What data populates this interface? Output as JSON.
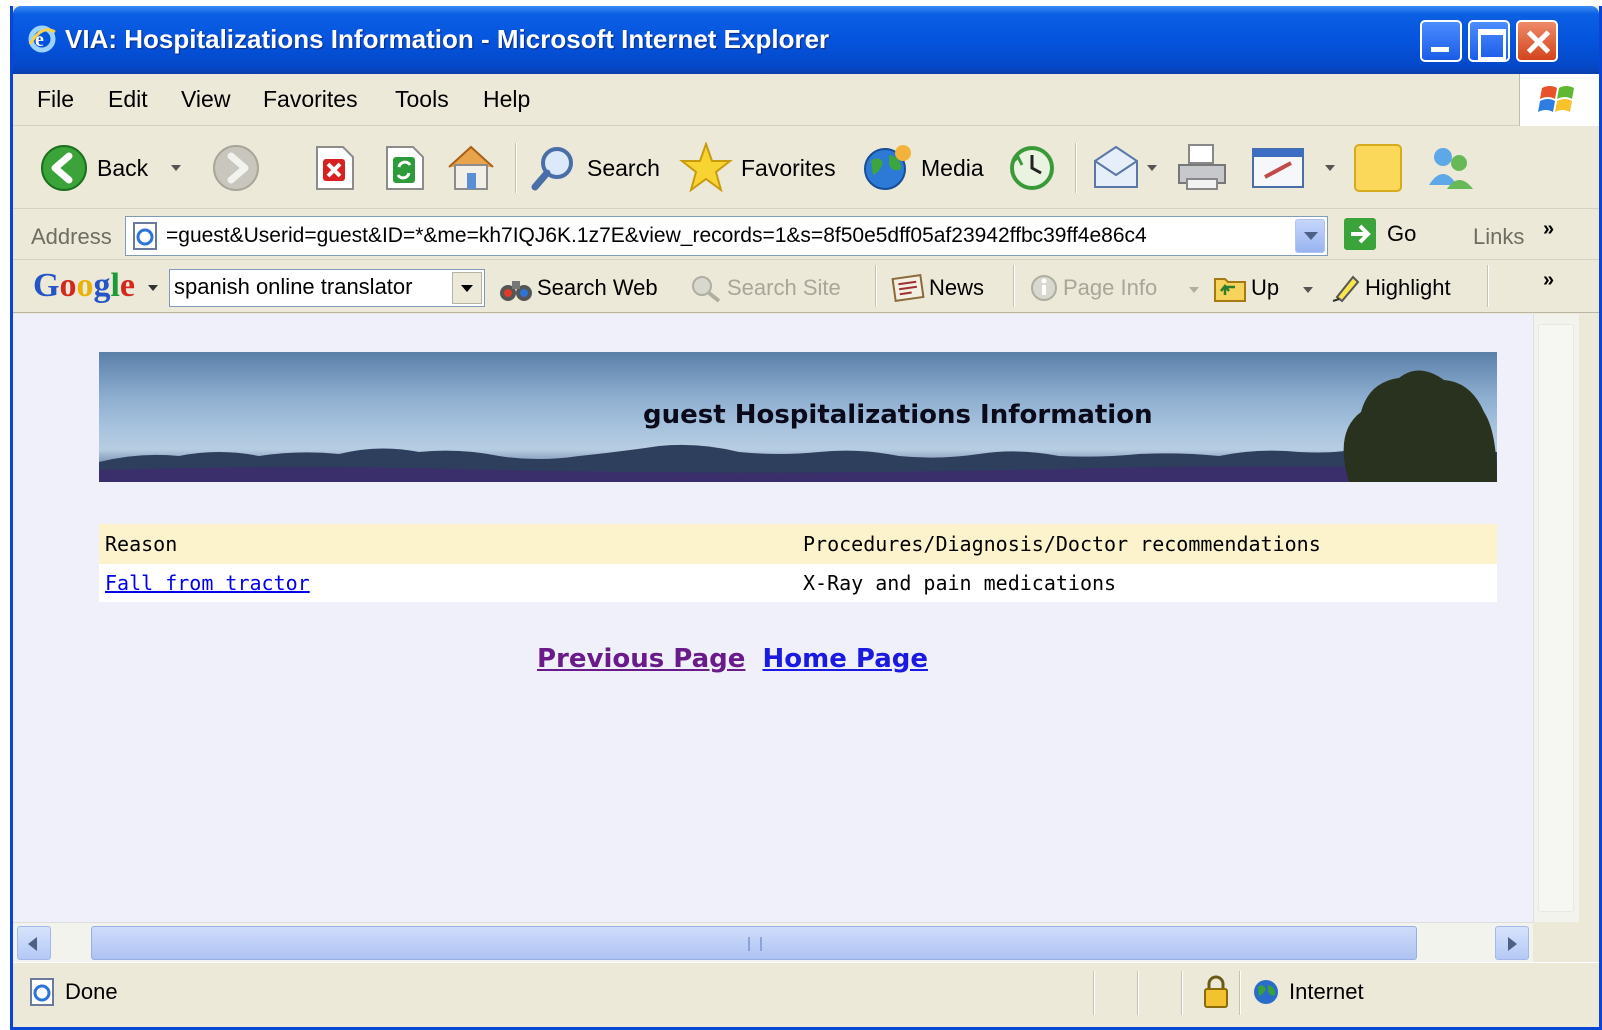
{
  "window": {
    "title": "VIA: Hospitalizations Information - Microsoft Internet Explorer"
  },
  "menu": {
    "file": "File",
    "edit": "Edit",
    "view": "View",
    "favorites": "Favorites",
    "tools": "Tools",
    "help": "Help"
  },
  "toolbar": {
    "back": "Back",
    "search": "Search",
    "favorites": "Favorites",
    "media": "Media"
  },
  "address": {
    "label": "Address",
    "url": "=guest&Userid=guest&ID=*&me=kh7IQJ6K.1z7E&view_records=1&s=8f50e5dff05af23942ffbc39ff4e86c4",
    "go": "Go",
    "links": "Links"
  },
  "google": {
    "logo": "Google",
    "query": "spanish online translator",
    "search_web": "Search Web",
    "search_site": "Search Site",
    "news": "News",
    "page_info": "Page Info",
    "up": "Up",
    "highlight": "Highlight"
  },
  "page": {
    "banner_title": "guest Hospitalizations Information",
    "table": {
      "headers": [
        "Reason",
        "Procedures/Diagnosis/Doctor recommendations"
      ],
      "rows": [
        {
          "reason": "Fall from tractor",
          "procedures": "X-Ray and pain medications"
        }
      ]
    },
    "previous_page": "Previous Page",
    "home_page": "Home Page"
  },
  "status": {
    "text": "Done",
    "zone": "Internet"
  },
  "colors": {
    "titlebar": "#0554de",
    "table_header": "#fcf3cc",
    "visited_link": "#6a1b8a",
    "link": "#1a1ae0"
  }
}
